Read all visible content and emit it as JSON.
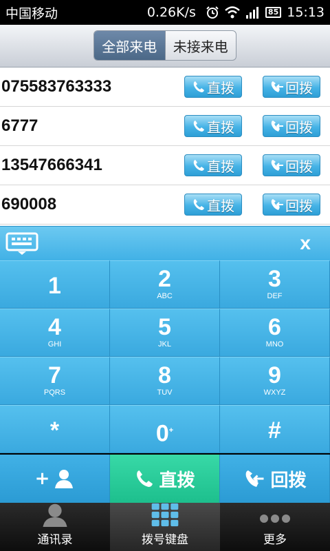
{
  "status_bar": {
    "carrier": "中国移动",
    "speed": "0.26K/s",
    "battery": "85",
    "time": "15:13"
  },
  "segments": {
    "all": "全部来电",
    "missed": "未接来电"
  },
  "calls": [
    {
      "number": "075583763333"
    },
    {
      "number": "6777"
    },
    {
      "number": "13547666341"
    },
    {
      "number": "690008"
    }
  ],
  "row_buttons": {
    "direct": "直拨",
    "callback": "回拨"
  },
  "keypad_header": {
    "close": "x"
  },
  "keys": [
    {
      "digit": "1",
      "letters": ""
    },
    {
      "digit": "2",
      "letters": "ABC"
    },
    {
      "digit": "3",
      "letters": "DEF"
    },
    {
      "digit": "4",
      "letters": "GHI"
    },
    {
      "digit": "5",
      "letters": "JKL"
    },
    {
      "digit": "6",
      "letters": "MNO"
    },
    {
      "digit": "7",
      "letters": "PQRS"
    },
    {
      "digit": "8",
      "letters": "TUV"
    },
    {
      "digit": "9",
      "letters": "WXYZ"
    },
    {
      "digit": "*",
      "letters": ""
    },
    {
      "digit": "0",
      "letters": "+"
    },
    {
      "digit": "#",
      "letters": ""
    }
  ],
  "actions": {
    "add_contact": "+",
    "direct": "直拨",
    "callback": "回拨"
  },
  "tabs": {
    "contacts": "通讯录",
    "keypad": "拨号键盘",
    "more": "更多"
  },
  "colors": {
    "key_blue": "#4db8ea",
    "dial_green": "#2acd9a",
    "header_blue": "#4b6887"
  }
}
